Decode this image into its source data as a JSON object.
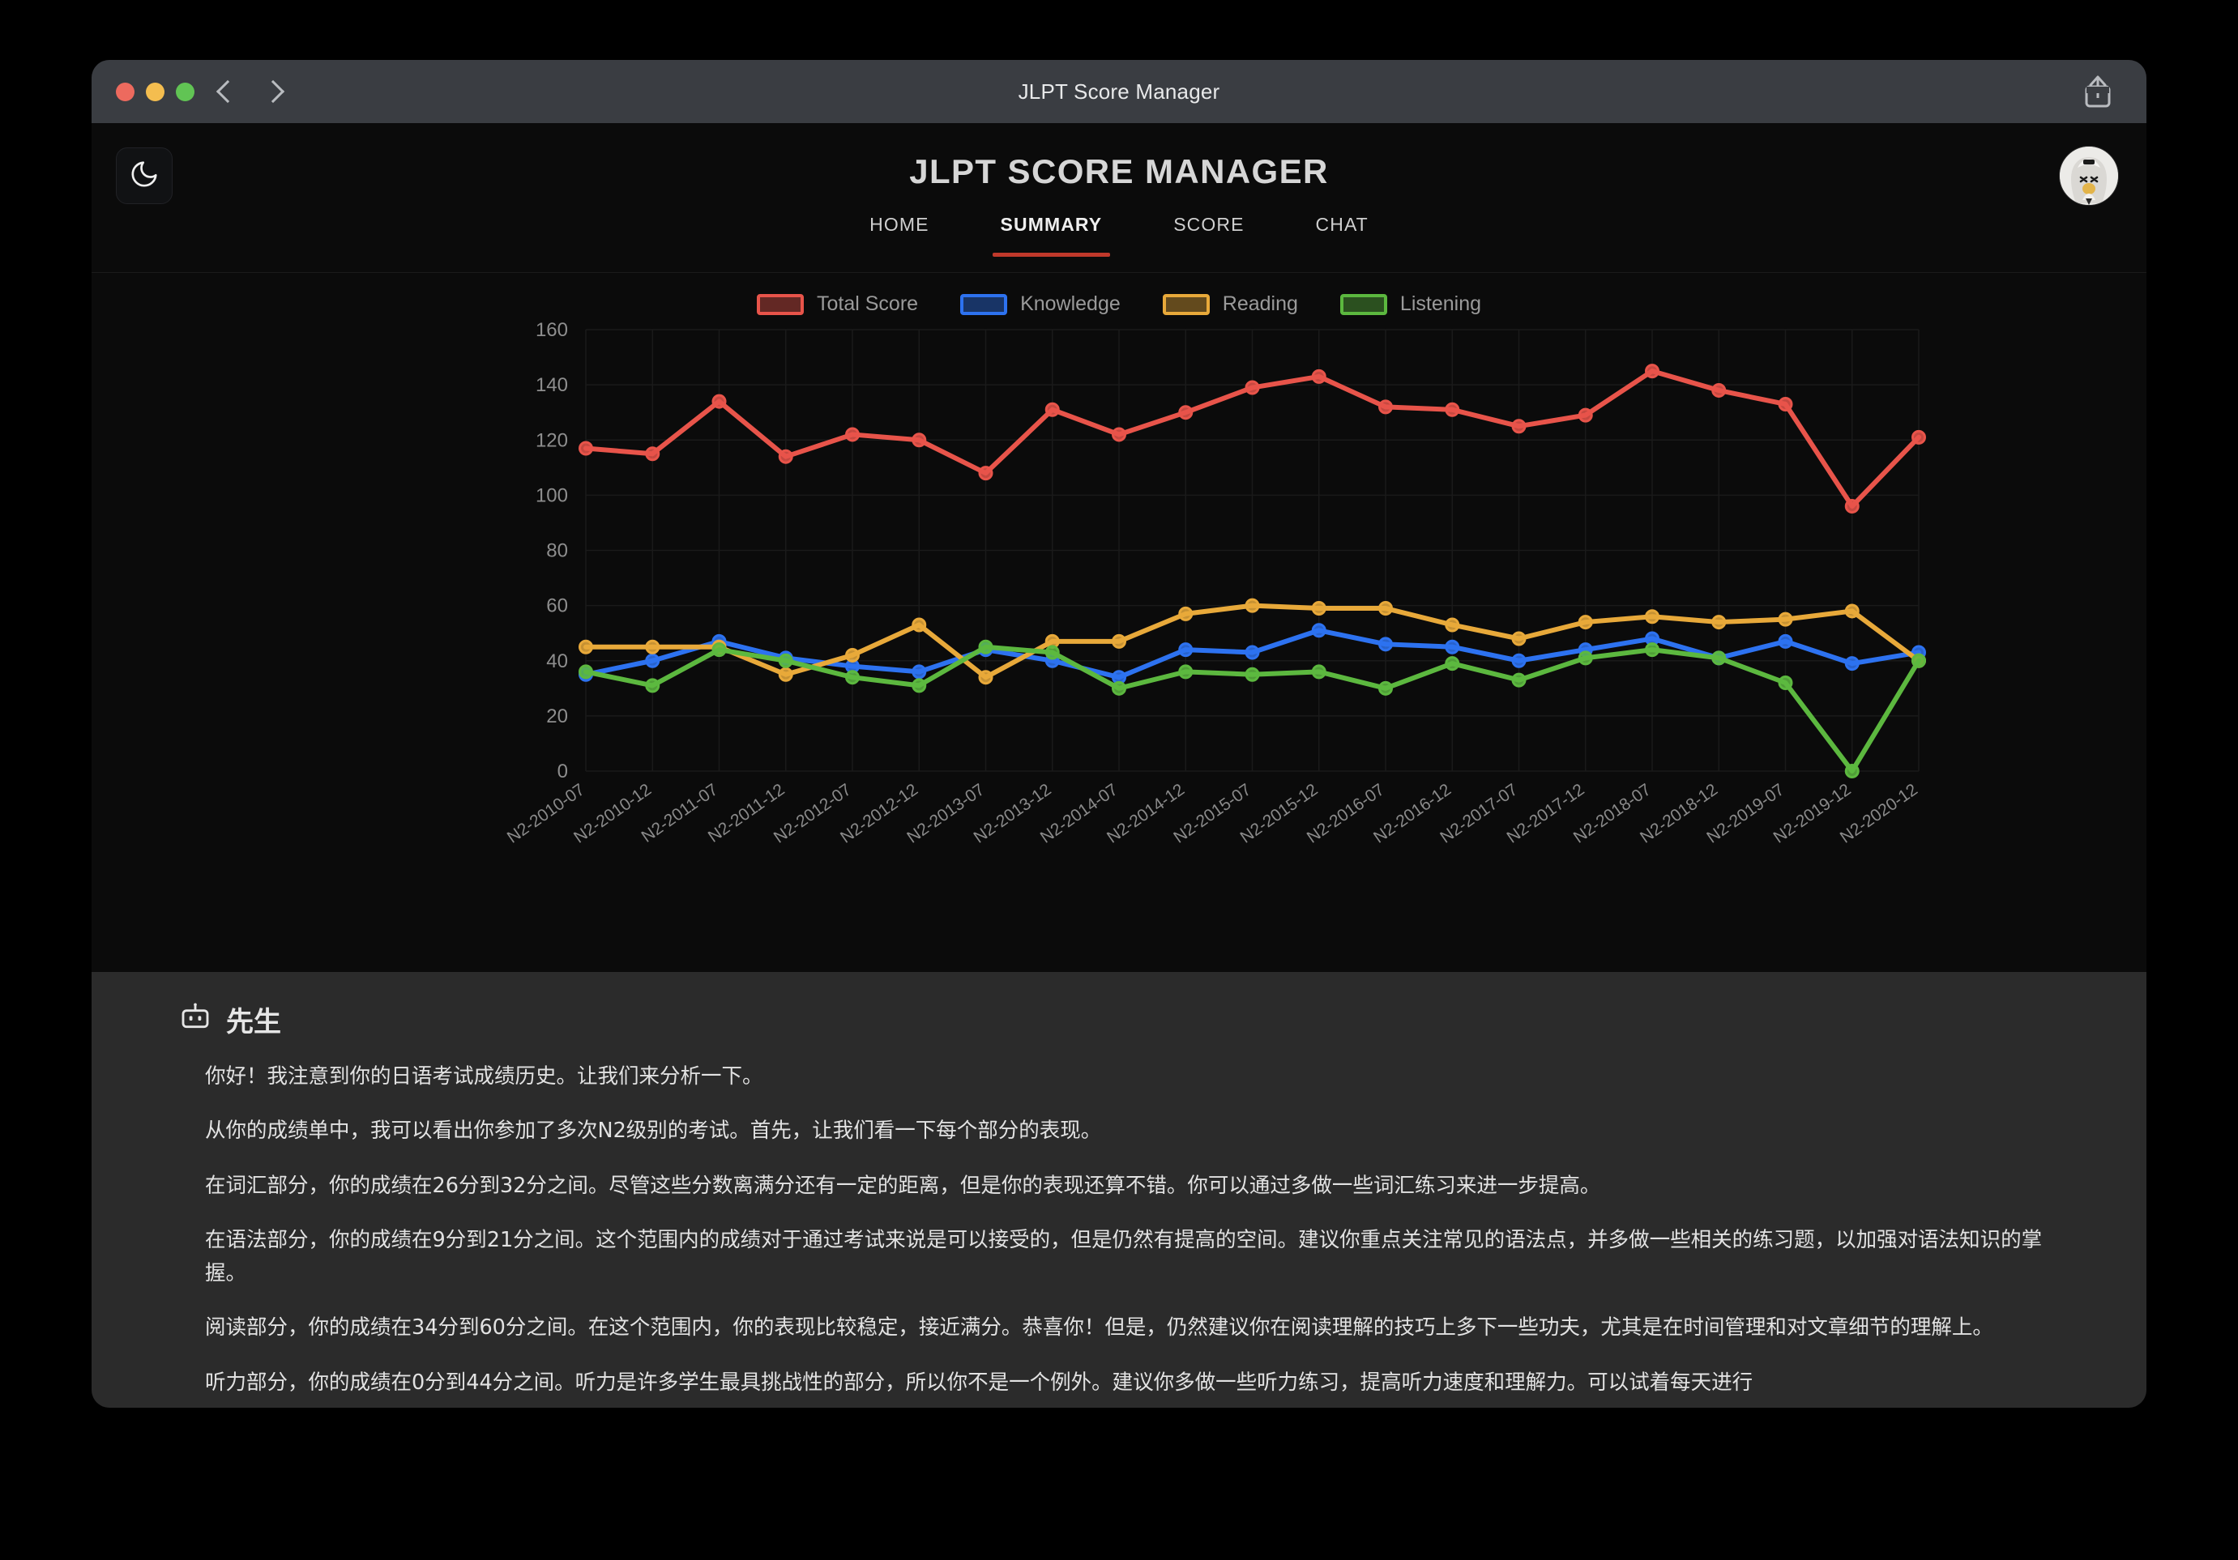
{
  "window": {
    "title": "JLPT Score Manager",
    "traffic_lights": [
      "close",
      "minimize",
      "zoom"
    ],
    "back_label": "Back",
    "forward_label": "Forward",
    "share_label": "Share"
  },
  "header": {
    "app_title": "JLPT SCORE MANAGER",
    "theme_toggle_icon": "moon-icon",
    "avatar_icon": "user-avatar",
    "tabs": [
      {
        "label": "HOME",
        "active": false
      },
      {
        "label": "SUMMARY",
        "active": true
      },
      {
        "label": "SCORE",
        "active": false
      },
      {
        "label": "CHAT",
        "active": false
      }
    ]
  },
  "chart_data": {
    "type": "line",
    "title": "",
    "xlabel": "",
    "ylabel": "",
    "ylim": [
      0,
      160
    ],
    "yticks": [
      0,
      20,
      40,
      60,
      80,
      100,
      120,
      140,
      160
    ],
    "grid": true,
    "legend_position": "top-center",
    "categories": [
      "N2-2010-07",
      "N2-2010-12",
      "N2-2011-07",
      "N2-2011-12",
      "N2-2012-07",
      "N2-2012-12",
      "N2-2013-07",
      "N2-2013-12",
      "N2-2014-07",
      "N2-2014-12",
      "N2-2015-07",
      "N2-2015-12",
      "N2-2016-07",
      "N2-2016-12",
      "N2-2017-07",
      "N2-2017-12",
      "N2-2018-07",
      "N2-2018-12",
      "N2-2019-07",
      "N2-2019-12",
      "N2-2020-12"
    ],
    "series": [
      {
        "name": "Total Score",
        "color": "#e8544a",
        "values": [
          117,
          115,
          134,
          114,
          122,
          120,
          108,
          131,
          122,
          130,
          139,
          143,
          132,
          131,
          125,
          129,
          145,
          138,
          133,
          96,
          121
        ]
      },
      {
        "name": "Knowledge",
        "color": "#2d72f0",
        "values": [
          35,
          40,
          47,
          41,
          38,
          36,
          44,
          40,
          34,
          44,
          43,
          51,
          46,
          45,
          40,
          44,
          48,
          41,
          47,
          39,
          43
        ]
      },
      {
        "name": "Reading",
        "color": "#e8a93a",
        "values": [
          45,
          45,
          45,
          35,
          42,
          53,
          34,
          47,
          47,
          57,
          60,
          59,
          59,
          53,
          48,
          54,
          56,
          54,
          55,
          58,
          40
        ]
      },
      {
        "name": "Listening",
        "color": "#5cb83f",
        "values": [
          36,
          31,
          44,
          40,
          34,
          31,
          45,
          43,
          30,
          36,
          35,
          36,
          30,
          39,
          33,
          41,
          44,
          41,
          32,
          0,
          40
        ]
      }
    ]
  },
  "chat": {
    "sender_icon": "robot-icon",
    "sender": "先生",
    "messages": [
      "你好！我注意到你的日语考试成绩历史。让我们来分析一下。",
      "从你的成绩单中，我可以看出你参加了多次N2级别的考试。首先，让我们看一下每个部分的表现。",
      "在词汇部分，你的成绩在26分到32分之间。尽管这些分数离满分还有一定的距离，但是你的表现还算不错。你可以通过多做一些词汇练习来进一步提高。",
      "在语法部分，你的成绩在9分到21分之间。这个范围内的成绩对于通过考试来说是可以接受的，但是仍然有提高的空间。建议你重点关注常见的语法点，并多做一些相关的练习题，以加强对语法知识的掌握。",
      "阅读部分，你的成绩在34分到60分之间。在这个范围内，你的表现比较稳定，接近满分。恭喜你！但是，仍然建议你在阅读理解的技巧上多下一些功夫，尤其是在时间管理和对文章细节的理解上。",
      "听力部分，你的成绩在0分到44分之间。听力是许多学生最具挑战性的部分，所以你不是一个例外。建议你多做一些听力练习，提高听力速度和理解力。可以试着每天进行"
    ]
  }
}
